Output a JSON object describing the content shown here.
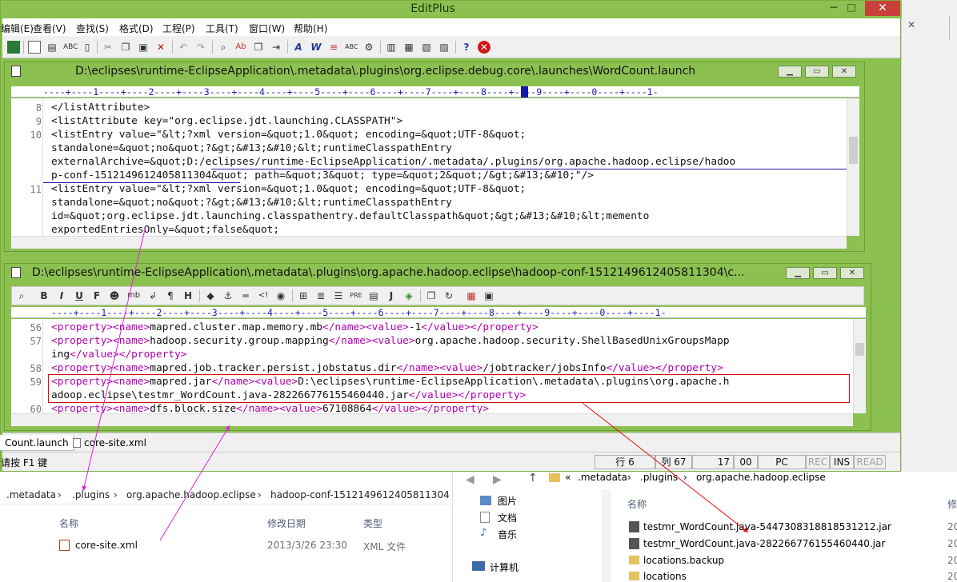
{
  "app": {
    "title": "EditPlus",
    "controls": {
      "minimize": "─",
      "maximize": "□",
      "close": "✕"
    }
  },
  "menu": [
    "编辑(E)",
    "查看(V)",
    "查找(S)",
    "格式(D)",
    "工程(P)",
    "工具(T)",
    "窗口(W)",
    "帮助(H)"
  ],
  "window1": {
    "title": "D:\\eclipses\\runtime-EclipseApplication\\.metadata\\.plugins\\org.eclipse.debug.core\\.launches\\WordCount.launch",
    "ruler": "----+----1----+----2----+----3----+----4----+----5----+----6----+----7----+----8----+----9----+----0----+----1-",
    "lines": [
      {
        "num": "8",
        "text": "</listAttribute>"
      },
      {
        "num": "9",
        "text": "<listAttribute key=\"org.eclipse.jdt.launching.CLASSPATH\">"
      },
      {
        "num": "10",
        "text": "<listEntry value=\"&lt;?xml version=&quot;1.0&quot; encoding=&quot;UTF-8&quot;"
      },
      {
        "num": "",
        "text": "standalone=&quot;no&quot;?&gt;&#13;&#10;&lt;runtimeClasspathEntry"
      },
      {
        "num": "",
        "text": "externalArchive=&quot;D:/eclipses/runtime-EclipseApplication/.metadata/.plugins/org.apache.hadoop.eclipse/hadoo"
      },
      {
        "num": "",
        "text": "p-conf-1512149612405811304&quot; path=&quot;3&quot; type=&quot;2&quot;/&gt;&#13;&#10;\"/>"
      },
      {
        "num": "11",
        "text": "<listEntry value=\"&lt;?xml version=&quot;1.0&quot; encoding=&quot;UTF-8&quot;"
      },
      {
        "num": "",
        "text": "standalone=&quot;no&quot;?&gt;&#13;&#10;&lt;runtimeClasspathEntry"
      },
      {
        "num": "",
        "text": "id=&quot;org.eclipse.jdt.launching.classpathentry.defaultClasspath&quot;&gt;&#13;&#10;&lt;memento"
      },
      {
        "num": "",
        "text": "exportedEntriesOnly=&quot;false&quot;"
      }
    ]
  },
  "window2": {
    "title": "D:\\eclipses\\runtime-EclipseApplication\\.metadata\\.plugins\\org.apache.hadoop.eclipse\\hadoop-conf-1512149612405811304\\c...",
    "ruler": "----+----1----+----2----+----3----+----4----+----5----+----6----+----7----+----8----+----9----+----0----+----1-",
    "toolbar": [
      "B",
      "I",
      "U",
      "F",
      "mb",
      "↲",
      "¶",
      "H"
    ],
    "lines": [
      {
        "num": "56",
        "parts": [
          "<property>",
          "<name>",
          "mapred.cluster.map.memory.mb",
          "</name>",
          "<value>",
          "-1",
          "</value>",
          "</property>"
        ]
      },
      {
        "num": "57",
        "parts": [
          "<property>",
          "<name>",
          "hadoop.security.group.mapping",
          "</name>",
          "<value>",
          "org.apache.hadoop.security.ShellBasedUnixGroupsMapp"
        ]
      },
      {
        "num": "",
        "parts": [
          "ing",
          "</value>",
          "</property>"
        ]
      },
      {
        "num": "58",
        "parts": [
          "<property>",
          "<name>",
          "mapred.job.tracker.persist.jobstatus.dir",
          "</name>",
          "<value>",
          "/jobtracker/jobsInfo",
          "</value>",
          "</property>"
        ]
      },
      {
        "num": "59",
        "parts": [
          "<property>",
          "<name>",
          "mapred.jar",
          "</name>",
          "<value>",
          "D:\\eclipses\\runtime-EclipseApplication\\.metadata\\.plugins\\org.apache.h"
        ]
      },
      {
        "num": "",
        "parts": [
          "adoop.eclipse\\testmr_WordCount.java-282266776155460440.jar",
          "</value>",
          "</property>"
        ]
      },
      {
        "num": "60",
        "parts": [
          "<property>",
          "<name>",
          "dfs.block.size",
          "</name>",
          "<value>",
          "67108864",
          "</value>",
          "</property>"
        ]
      }
    ]
  },
  "tabs": [
    "Count.launch",
    "core-site.xml"
  ],
  "status": {
    "hint": "请按 F1 键",
    "row": "行 6",
    "col": "列 67",
    "n1": "17",
    "n2": "00",
    "mode": "PC",
    "rec": "REC",
    "ins": "INS",
    "read": "READ"
  },
  "explorer_left": {
    "breadcrumb": [
      ".metadata",
      "›",
      ".plugins",
      "›",
      "org.apache.hadoop.eclipse",
      "›",
      "hadoop-conf-1512149612405811304"
    ],
    "columns": {
      "name": "名称",
      "date": "修改日期",
      "type": "类型"
    },
    "files": [
      {
        "name": "core-site.xml",
        "date": "2013/3/26 23:30",
        "type": "XML 文件"
      }
    ]
  },
  "explorer_right": {
    "breadcrumb": [
      "«",
      ".metadata",
      "›",
      ".plugins",
      "›",
      "org.apache.hadoop.eclipse"
    ],
    "nav": [
      "图片",
      "文档",
      "音乐",
      "计算机"
    ],
    "column_name": "名称",
    "column_cut": "修",
    "files": [
      {
        "name": "testmr_WordCount.java-5447308318818531212.jar",
        "date": "20"
      },
      {
        "name": "testmr_WordCount.java-282266776155460440.jar",
        "date": "20"
      },
      {
        "name": "locations.backup",
        "date": "20"
      },
      {
        "name": "locations",
        "date": "20"
      }
    ]
  }
}
